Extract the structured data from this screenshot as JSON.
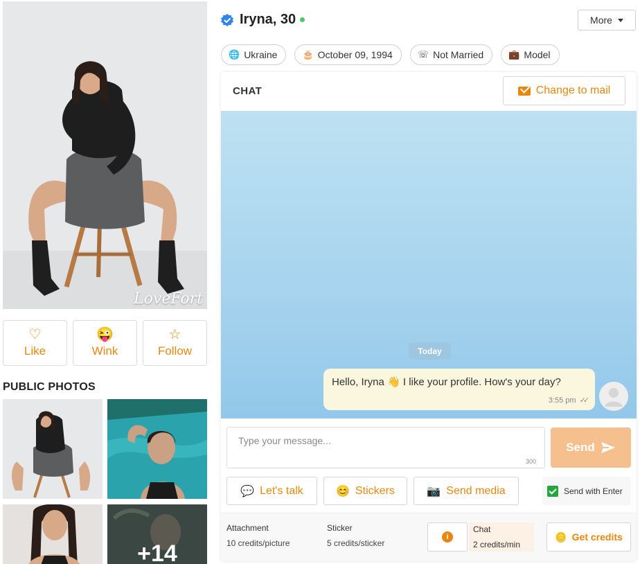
{
  "colors": {
    "accent": "#e8870d",
    "online": "#4cc76a",
    "verified": "#2f86e8",
    "send_disabled": "#f6c08e"
  },
  "gallery": {
    "watermark": "LoveFort",
    "actions": [
      {
        "icon": "heart-icon",
        "label": "Like"
      },
      {
        "icon": "wink-emoji-icon",
        "label": "Wink"
      },
      {
        "icon": "star-icon",
        "label": "Follow"
      }
    ],
    "public_photos_title": "PUBLIC PHOTOS",
    "more_count": "+14"
  },
  "profile": {
    "name": "Iryna, 30",
    "more_label": "More",
    "chips": [
      {
        "icon": "globe-icon",
        "label": "Ukraine"
      },
      {
        "icon": "cake-icon",
        "label": "October 09, 1994"
      },
      {
        "icon": "rings-icon",
        "label": "Not Married"
      },
      {
        "icon": "briefcase-icon",
        "label": "Model"
      }
    ]
  },
  "chat": {
    "title": "CHAT",
    "change_to_mail": "Change to mail",
    "day_separator": "Today",
    "message": {
      "text": "Hello, Iryna 👋 I like your profile. How's your day?",
      "time": "3:55 pm"
    },
    "input_placeholder": "Type your message...",
    "char_limit": "300",
    "send_label": "Send",
    "tools": [
      {
        "icon": "hi-bubble-icon",
        "label": "Let's talk"
      },
      {
        "icon": "smile-sticker-icon",
        "label": "Stickers"
      },
      {
        "icon": "camera-icon",
        "label": "Send media"
      }
    ],
    "send_with_enter": "Send with Enter",
    "pricing": {
      "attachment": {
        "name": "Attachment",
        "value": "10 credits/picture"
      },
      "sticker": {
        "name": "Sticker",
        "value": "5 credits/sticker"
      },
      "chat": {
        "name": "Chat",
        "value": "2 credits/min"
      }
    },
    "get_credits": "Get credits"
  }
}
